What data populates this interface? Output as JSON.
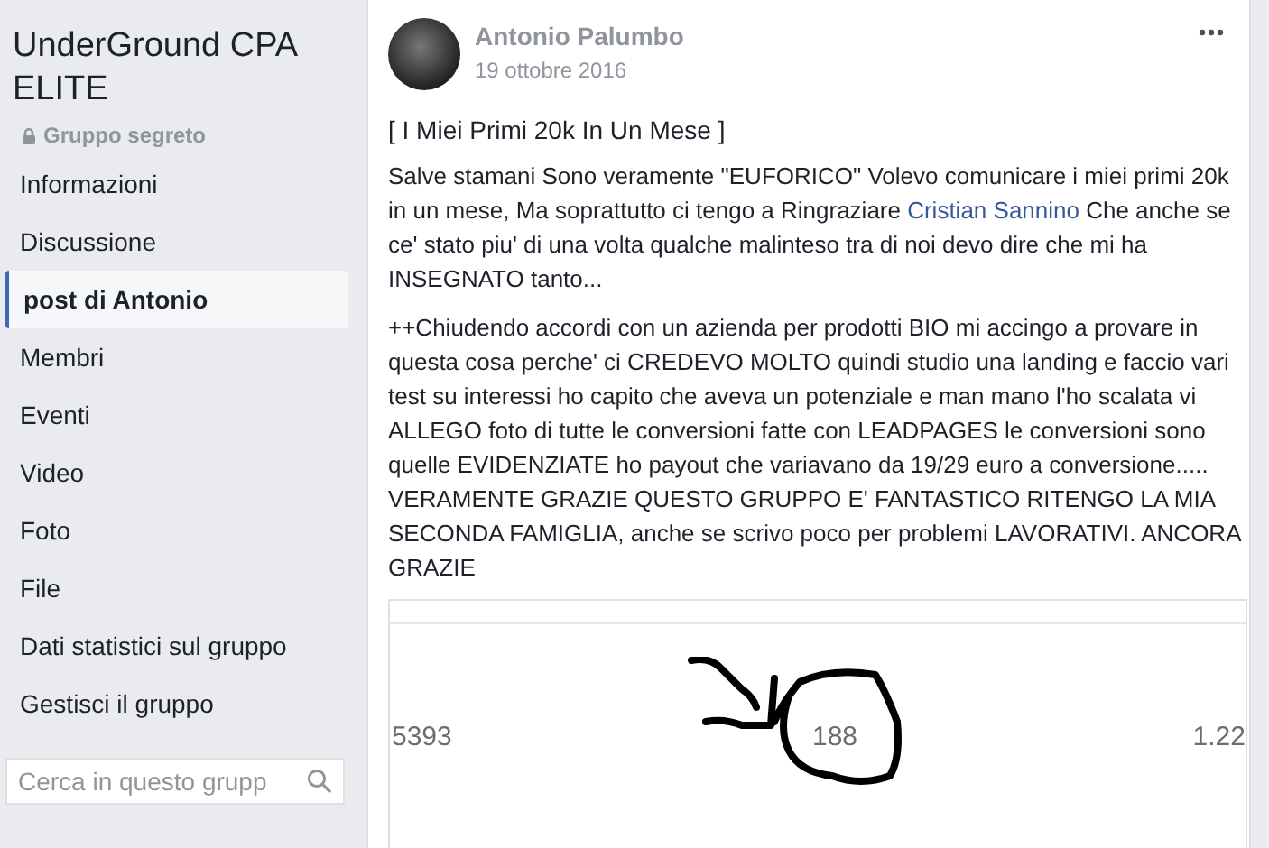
{
  "group": {
    "title": "UnderGround CPA ELITE",
    "privacy": "Gruppo segreto"
  },
  "sidebar": {
    "items": [
      {
        "label": "Informazioni",
        "selected": false
      },
      {
        "label": "Discussione",
        "selected": false
      },
      {
        "label": "post di Antonio",
        "selected": true
      },
      {
        "label": "Membri",
        "selected": false
      },
      {
        "label": "Eventi",
        "selected": false
      },
      {
        "label": "Video",
        "selected": false
      },
      {
        "label": "Foto",
        "selected": false
      },
      {
        "label": "File",
        "selected": false
      },
      {
        "label": "Dati statistici sul gruppo",
        "selected": false
      },
      {
        "label": "Gestisci il gruppo",
        "selected": false
      }
    ],
    "search": {
      "placeholder": "Cerca in questo grupp"
    }
  },
  "post": {
    "author": "Antonio Palumbo",
    "date": "19 ottobre 2016",
    "title": "[ I Miei Primi 20k In Un Mese ]",
    "paragraphs": [
      [
        {
          "kind": "text",
          "text": "Salve stamani Sono veramente \"EUFORICO\" Volevo comunicare i miei primi 20k in un mese, Ma soprattutto ci tengo a Ringraziare "
        },
        {
          "kind": "mention",
          "text": "Cristian Sannino"
        },
        {
          "kind": "text",
          "text": " Che anche se ce' stato piu' di una volta qualche malinteso tra di noi devo dire che mi ha INSEGNATO tanto..."
        }
      ],
      [
        {
          "kind": "text",
          "text": "++Chiudendo accordi con un azienda per prodotti BIO mi accingo a provare in questa cosa perche' ci CREDEVO MOLTO quindi studio una landing e faccio vari test su interessi ho capito che aveva un potenziale e man mano l'ho scalata vi ALLEGO foto di tutte le conversioni fatte con LEADPAGES le conversioni sono quelle EVIDENZIATE ho payout che variavano da 19/29 euro a conversione..... VERAMENTE GRAZIE QUESTO GRUPPO E' FANTASTICO RITENGO LA MIA SECONDA FAMIGLIA, anche se scrivo poco per problemi LAVORATIVI. ANCORA GRAZIE"
        }
      ]
    ],
    "attachment": {
      "cells": [
        "5393",
        "188",
        "1.22"
      ]
    }
  }
}
